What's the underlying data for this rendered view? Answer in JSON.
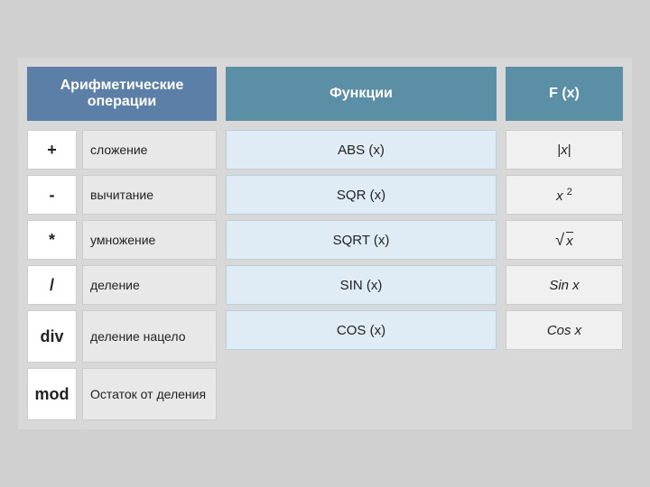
{
  "header": {
    "arith_label": "Арифметические операции",
    "func_label": "Функции",
    "fx_label": "F (x)"
  },
  "arithmetic": [
    {
      "symbol": "+",
      "label": "сложение"
    },
    {
      "symbol": "-",
      "label": "вычитание"
    },
    {
      "symbol": "*",
      "label": "умножение"
    },
    {
      "symbol": "/",
      "label": "деление"
    },
    {
      "symbol": "div",
      "label": "деление нацело"
    },
    {
      "symbol": "mod",
      "label": "Остаток от деления"
    }
  ],
  "functions": [
    {
      "name": "ABS (x)",
      "fx": "|x|",
      "fx_type": "plain"
    },
    {
      "name": "SQR (x)",
      "fx": "x²",
      "fx_type": "power"
    },
    {
      "name": "SQRT (x)",
      "fx": "√x",
      "fx_type": "sqrt"
    },
    {
      "name": "SIN (x)",
      "fx": "Sin x",
      "fx_type": "italic"
    },
    {
      "name": "COS (x)",
      "fx": "Cos x",
      "fx_type": "italic"
    }
  ]
}
